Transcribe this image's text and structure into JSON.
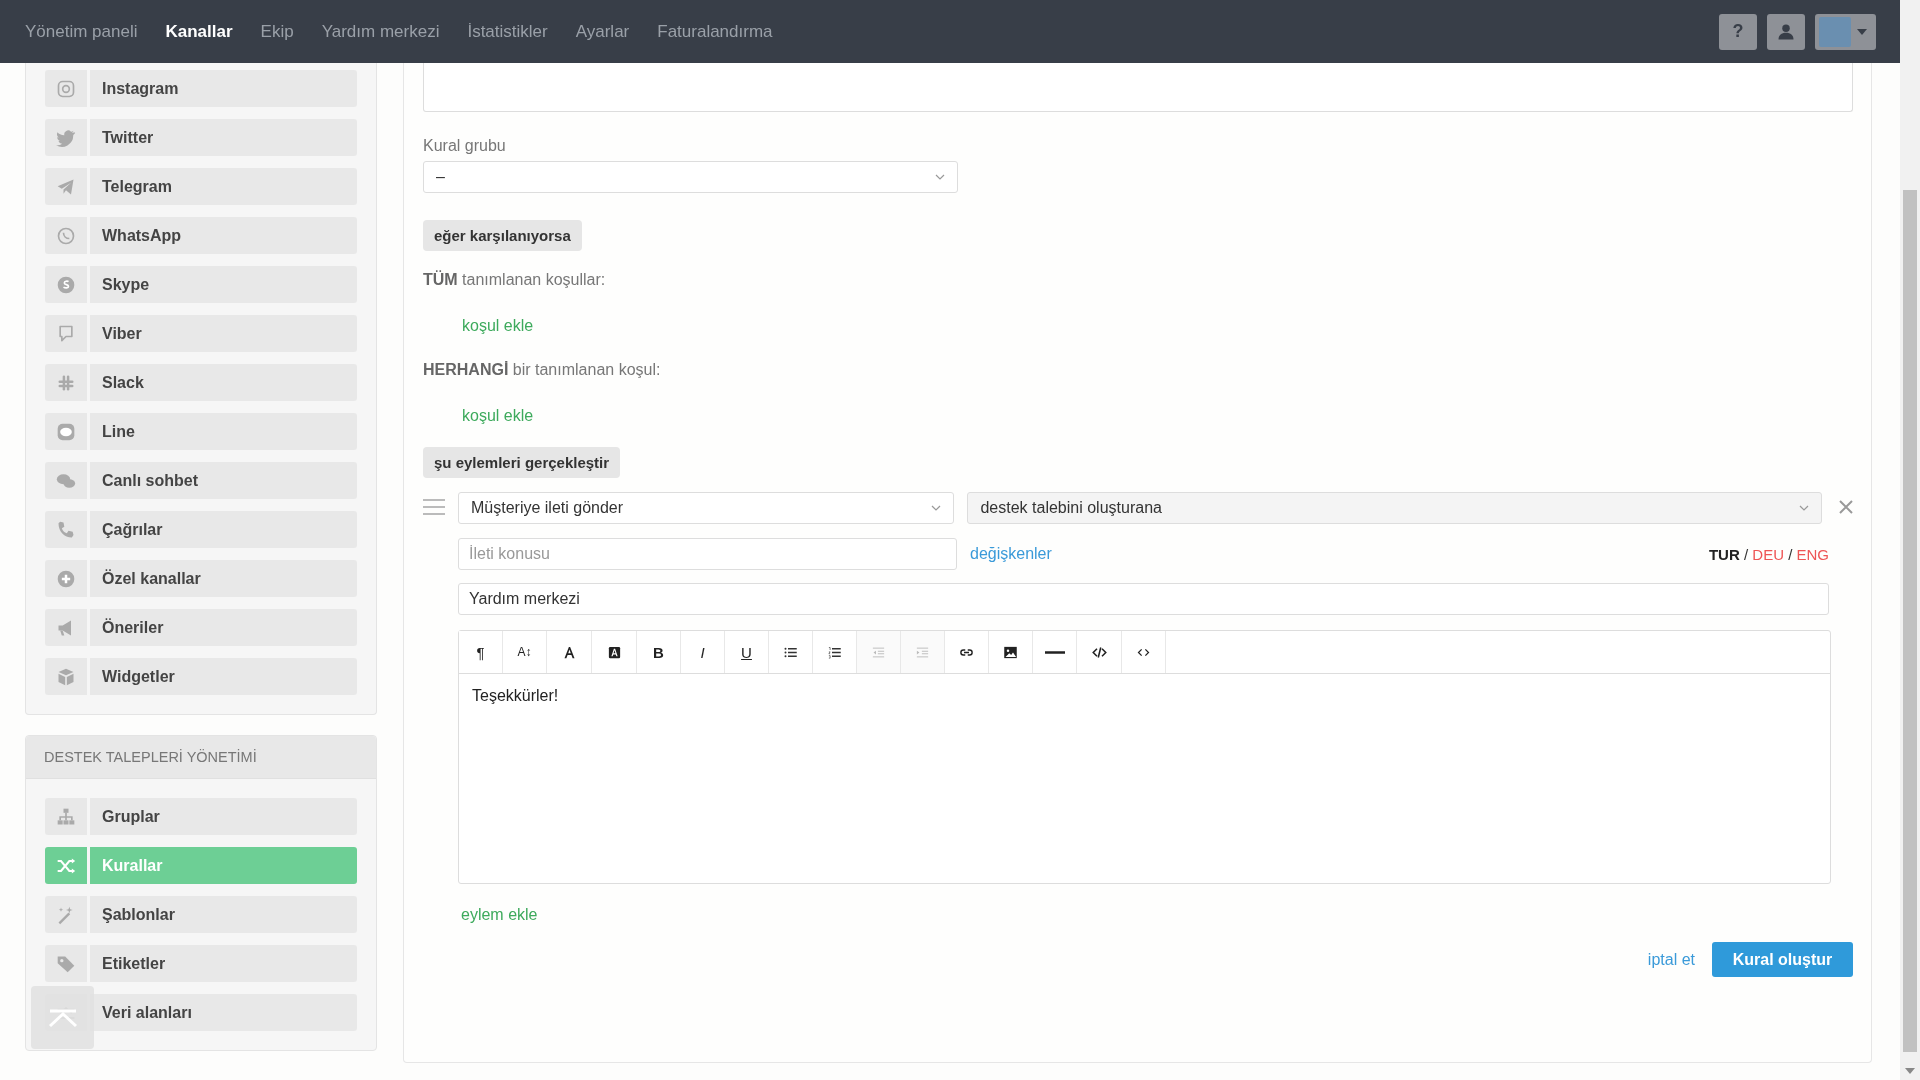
{
  "nav": {
    "items": [
      {
        "label": "Yönetim paneli",
        "selected": false
      },
      {
        "label": "Kanallar",
        "selected": true
      },
      {
        "label": "Ekip",
        "selected": false
      },
      {
        "label": "Yardım merkezi",
        "selected": false
      },
      {
        "label": "İstatistikler",
        "selected": false
      },
      {
        "label": "Ayarlar",
        "selected": false
      },
      {
        "label": "Faturalandırma",
        "selected": false
      }
    ],
    "help_button": "?"
  },
  "sidebar": {
    "channels": [
      {
        "label": "Instagram",
        "selected": false
      },
      {
        "label": "Twitter",
        "selected": false
      },
      {
        "label": "Telegram",
        "selected": false
      },
      {
        "label": "WhatsApp",
        "selected": false
      },
      {
        "label": "Skype",
        "selected": false
      },
      {
        "label": "Viber",
        "selected": false
      },
      {
        "label": "Slack",
        "selected": false
      },
      {
        "label": "Line",
        "selected": false
      },
      {
        "label": "Canlı sohbet",
        "selected": false
      },
      {
        "label": "Çağrılar",
        "selected": false
      },
      {
        "label": "Özel kanallar",
        "selected": false
      },
      {
        "label": "Öneriler",
        "selected": false
      },
      {
        "label": "Widgetler",
        "selected": false
      }
    ],
    "ticket_section": {
      "title": "DESTEK TALEPLERİ YÖNETİMİ",
      "items": [
        {
          "label": "Gruplar",
          "selected": false
        },
        {
          "label": "Kurallar",
          "selected": true
        },
        {
          "label": "Şablonlar",
          "selected": false
        },
        {
          "label": "Etiketler",
          "selected": false
        },
        {
          "label": "Veri alanları",
          "selected": false
        }
      ]
    }
  },
  "form": {
    "rule_group": {
      "label": "Kural grubu",
      "value": "–"
    },
    "conditions_heading": "eğer karşılanıyorsa",
    "all_label": "**TÜM** tanımlanan koşullar:",
    "all_add": "koşul ekle",
    "any_label": "**HERHANGİ** bir tanımlanan koşul:",
    "any_add": "koşul ekle",
    "actions_heading": "şu eylemleri gerçekleştir",
    "action": {
      "type": "Müşteriye ileti gönder",
      "recipient": "destek talebini oluşturana",
      "subject": {
        "placeholder": "İleti konusu"
      },
      "variables_link": "değişkenler",
      "languages": [
        {
          "code": "TUR",
          "selected": true
        },
        {
          "code": "DEU",
          "selected": false
        },
        {
          "code": "ENG",
          "selected": false
        }
      ],
      "language_separators": [
        "/",
        "/"
      ],
      "title_value": "Yardım merkezi",
      "toolbar": [
        {
          "kind": "glyph",
          "label": "¶",
          "disabled": false
        },
        {
          "kind": "glyph",
          "label": "A↕",
          "disabled": false
        },
        {
          "kind": "font-color",
          "disabled": false
        },
        {
          "kind": "back-color",
          "disabled": false
        },
        {
          "kind": "glyph",
          "label": "B",
          "disabled": false
        },
        {
          "kind": "glyph",
          "label": "I",
          "disabled": false
        },
        {
          "kind": "glyph",
          "label": "U",
          "disabled": false
        },
        {
          "kind": "bullets",
          "disabled": false
        },
        {
          "kind": "numbers",
          "disabled": false
        },
        {
          "kind": "outdent",
          "disabled": true
        },
        {
          "kind": "indent",
          "disabled": true
        },
        {
          "kind": "link",
          "disabled": false
        },
        {
          "kind": "image",
          "disabled": false
        },
        {
          "kind": "rule",
          "disabled": false
        },
        {
          "kind": "code",
          "disabled": false
        },
        {
          "kind": "source",
          "disabled": false
        }
      ],
      "body": "Teşekkürler!"
    },
    "add_action": "eylem ekle",
    "cancel": "iptal et",
    "submit": "Kural oluştur"
  }
}
